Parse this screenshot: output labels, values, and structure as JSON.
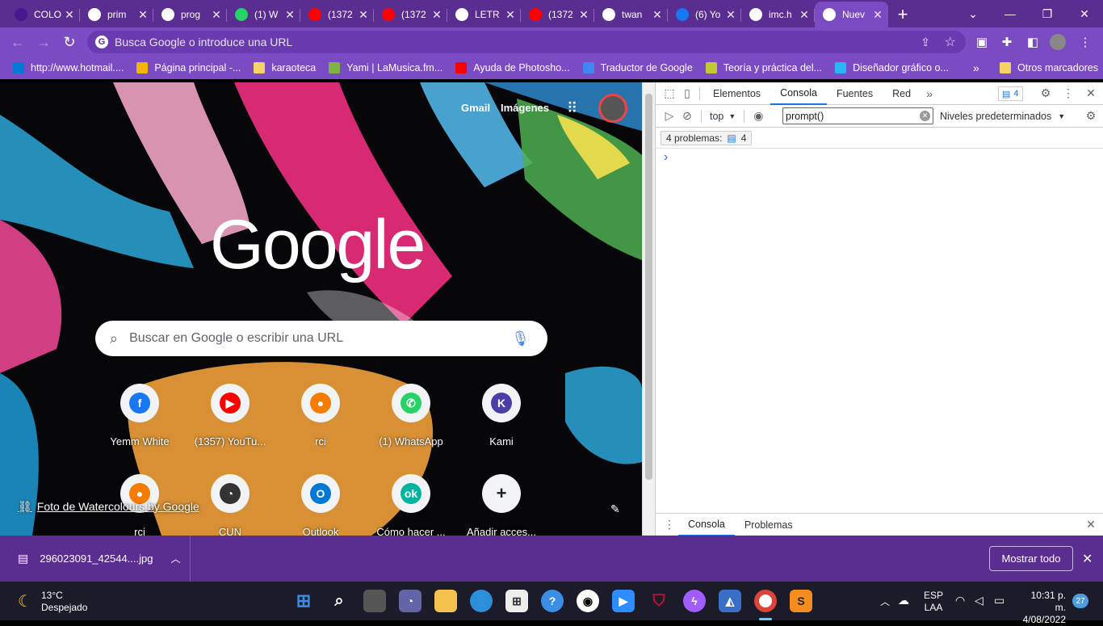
{
  "tabs": [
    {
      "title": "COLO",
      "icon": "kahoot-icon",
      "color": "#46178f"
    },
    {
      "title": "prim",
      "icon": "globe-icon",
      "color": "#ffffff"
    },
    {
      "title": "prog",
      "icon": "globe-icon",
      "color": "#ffffff"
    },
    {
      "title": "(1) W",
      "icon": "whatsapp-icon",
      "color": "#25d366"
    },
    {
      "title": "(1372",
      "icon": "youtube-icon",
      "color": "#ff0000"
    },
    {
      "title": "(1372",
      "icon": "youtube-icon",
      "color": "#ff0000"
    },
    {
      "title": "LETR",
      "icon": "google-icon",
      "color": "#ffffff"
    },
    {
      "title": "(1372",
      "icon": "youtube-icon",
      "color": "#ff0000"
    },
    {
      "title": "twan",
      "icon": "google-icon",
      "color": "#ffffff"
    },
    {
      "title": "(6) Yo",
      "icon": "facebook-icon",
      "color": "#1877f2"
    },
    {
      "title": "imc.h",
      "icon": "globe-icon",
      "color": "#ffffff"
    },
    {
      "title": "Nuev",
      "icon": "chrome-icon",
      "color": "#ffffff"
    }
  ],
  "omnibox": {
    "placeholder": "Busca Google o introduce una URL"
  },
  "bookmarks": [
    {
      "label": "http://www.hotmail....",
      "color": "#0078d4"
    },
    {
      "label": "Página principal -...",
      "color": "#f4b400"
    },
    {
      "label": "karaoteca",
      "color": "#f6d365"
    },
    {
      "label": "Yami | LaMusica.fm...",
      "color": "#7cb342"
    },
    {
      "label": "Ayuda de Photosho...",
      "color": "#ff0000"
    },
    {
      "label": "Traductor de Google",
      "color": "#4285f4"
    },
    {
      "label": "Teoría y práctica del...",
      "color": "#c0ca33"
    },
    {
      "label": "Diseñador gráfico o...",
      "color": "#29b6f6"
    }
  ],
  "bookmarks_other": "Otros marcadores",
  "ntp": {
    "gmail": "Gmail",
    "images": "Imágenes",
    "logo": "Google",
    "search_placeholder": "Buscar en Google o escribir una URL",
    "credit": "Foto de Watercolours by Google",
    "shortcuts": [
      {
        "label": "Yemm White",
        "icon": "facebook-icon",
        "color": "#1877f2"
      },
      {
        "label": "(1357) YouTu...",
        "icon": "youtube-icon",
        "color": "#ff0000"
      },
      {
        "label": "rci",
        "icon": "rci-icon",
        "color": "#f57c00"
      },
      {
        "label": "(1) WhatsApp",
        "icon": "whatsapp-icon",
        "color": "#25d366"
      },
      {
        "label": "Kami",
        "icon": "kami-icon",
        "color": "#4a3fa6"
      },
      {
        "label": "rci",
        "icon": "rci-icon",
        "color": "#f57c00"
      },
      {
        "label": "CUN",
        "icon": "cun-icon",
        "color": "#333333"
      },
      {
        "label": "Outlook",
        "icon": "outlook-icon",
        "color": "#0078d4"
      },
      {
        "label": "Cómo hacer ...",
        "icon": "ok-icon",
        "color": "#00b4a0"
      },
      {
        "label": "Añadir acces...",
        "icon": "plus-icon",
        "color": "#202124"
      }
    ]
  },
  "devtools": {
    "tabs": [
      "Elementos",
      "Consola",
      "Fuentes",
      "Red"
    ],
    "active_tab": "Consola",
    "issues_badge": "4",
    "context": "top",
    "filter_value": "prompt()",
    "levels": "Niveles predeterminados",
    "problems_label": "4 problemas:",
    "problems_count": "4",
    "prompt_glyph": "›",
    "drawer_tabs": [
      "Consola",
      "Problemas"
    ]
  },
  "download": {
    "filename": "296023091_42544....jpg",
    "show_all": "Mostrar todo"
  },
  "taskbar": {
    "weather_temp": "13°C",
    "weather_desc": "Despejado",
    "lang": "ESP",
    "lang_sub": "LAA",
    "time": "10:31 p. m.",
    "date": "4/08/2022",
    "notifications": "27"
  }
}
